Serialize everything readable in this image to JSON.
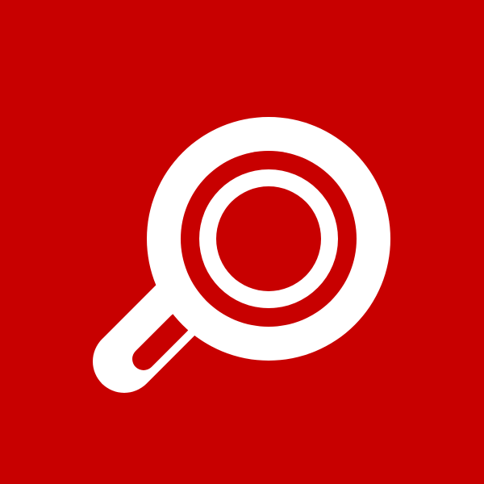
{
  "app_icon": {
    "icon": "search-icon",
    "colors": {
      "background": "#c80000",
      "foreground": "#ffffff"
    }
  }
}
